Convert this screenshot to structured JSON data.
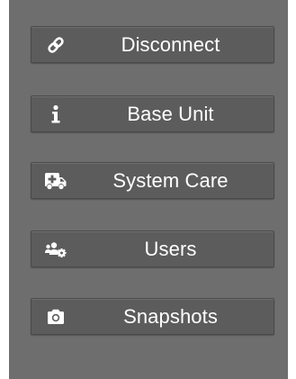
{
  "menu": {
    "items": [
      {
        "label": "Disconnect",
        "icon": "link-icon"
      },
      {
        "label": "Base Unit",
        "icon": "info-icon"
      },
      {
        "label": "System Care",
        "icon": "ambulance-icon"
      },
      {
        "label": "Users",
        "icon": "users-gear-icon"
      },
      {
        "label": "Snapshots",
        "icon": "camera-icon"
      }
    ]
  },
  "colors": {
    "panel_background": "#6e6e6e",
    "button_background": "#5c5c5c",
    "text": "#ffffff"
  }
}
